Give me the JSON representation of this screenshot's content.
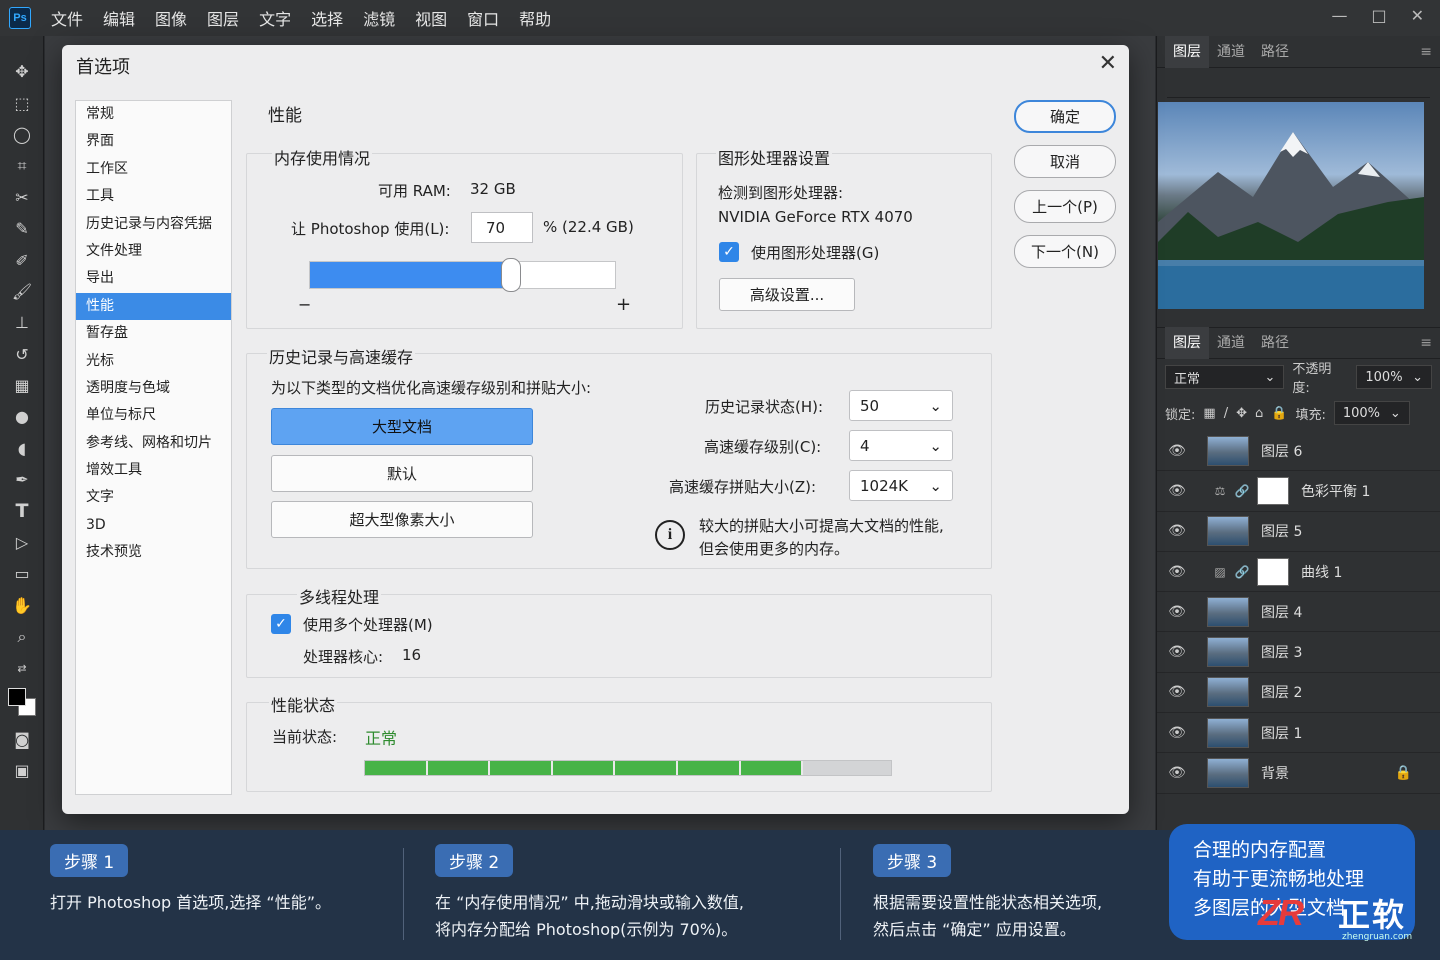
{
  "app": {
    "logo": "Ps",
    "menus": [
      "文件",
      "编辑",
      "图像",
      "图层",
      "文字",
      "选择",
      "滤镜",
      "视图",
      "窗口",
      "帮助"
    ]
  },
  "dialog": {
    "title": "首选项",
    "categories": [
      "常规",
      "界面",
      "工作区",
      "工具",
      "历史记录与内容凭据",
      "文件处理",
      "导出",
      "性能",
      "暂存盘",
      "光标",
      "透明度与色域",
      "单位与标尺",
      "参考线、网格和切片",
      "增效工具",
      "文字",
      "3D",
      "技术预览"
    ],
    "selected_category": "性能",
    "section_title": "性能",
    "memory": {
      "group_title": "内存使用情况",
      "available_label": "可用 RAM:",
      "available_value": "32 GB",
      "let_use_label": "让 Photoshop 使用(L):",
      "let_use_value": "70",
      "percent_text": "%  (22.4 GB)",
      "slider_percent": 0.66,
      "minus": "−",
      "plus": "+"
    },
    "gpu": {
      "group_title": "图形处理器设置",
      "detected_label": "检测到图形处理器:",
      "gpu_name": "NVIDIA GeForce RTX 4070",
      "use_gpu_label": "使用图形处理器(G)",
      "use_gpu_checked": true,
      "advanced_button": "高级设置..."
    },
    "history_cache": {
      "group_title": "历史记录与高速缓存",
      "description": "为以下类型的文档优化高速缓存级别和拼贴大小:",
      "buttons": [
        "大型文档",
        "默认",
        "超大型像素大小"
      ],
      "selected_button": "大型文档",
      "history_states_label": "历史记录状态(H):",
      "history_states_value": "50",
      "cache_levels_label": "高速缓存级别(C):",
      "cache_levels_value": "4",
      "cache_tile_label": "高速缓存拼贴大小(Z):",
      "cache_tile_value": "1024K",
      "info_line1": "较大的拼贴大小可提高大文档的性能,",
      "info_line2": "但会使用更多的内存。"
    },
    "multithread": {
      "group_title": "多线程处理",
      "use_multi_label": "使用多个处理器(M)",
      "use_multi_checked": true,
      "cores_label": "处理器核心:",
      "cores_value": "16"
    },
    "perf_status": {
      "group_title": "性能状态",
      "current_label": "当前状态:",
      "current_value": "正常",
      "filled_segments": 7,
      "status_color": "#47b347"
    },
    "side_buttons": {
      "ok": "确定",
      "cancel": "取消",
      "prev": "上一个(P)",
      "next": "下一个(N)"
    }
  },
  "right_panel": {
    "top_tabs": [
      "图层",
      "通道",
      "路径"
    ],
    "layers_tabs": [
      "图层",
      "通道",
      "路径"
    ],
    "blend_mode": "正常",
    "opacity_label": "不透明度:",
    "opacity_value": "100%",
    "lock_label": "锁定:",
    "fill_label": "填充:",
    "fill_value": "100%",
    "layers": [
      {
        "name": "图层 6",
        "type": "image"
      },
      {
        "name": "色彩平衡 1",
        "type": "adjustment",
        "icon": "scale-icon"
      },
      {
        "name": "图层 5",
        "type": "image"
      },
      {
        "name": "曲线 1",
        "type": "adjustment",
        "icon": "curves-icon"
      },
      {
        "name": "图层 4",
        "type": "image"
      },
      {
        "name": "图层 3",
        "type": "image"
      },
      {
        "name": "图层 2",
        "type": "image"
      },
      {
        "name": "图层 1",
        "type": "image"
      },
      {
        "name": "背景",
        "type": "background",
        "locked": true
      }
    ]
  },
  "steps": [
    {
      "badge": "步骤 1",
      "lines": [
        "打开 Photoshop 首选项,选择 “性能”。"
      ]
    },
    {
      "badge": "步骤 2",
      "lines": [
        "在 “内存使用情况” 中,拖动滑块或输入数值,",
        "将内存分配给 Photoshop(示例为 70%)。"
      ]
    },
    {
      "badge": "步骤 3",
      "lines": [
        "根据需要设置性能状态相关选项,",
        "然后点击 “确定” 应用设置。"
      ]
    }
  ],
  "callout": {
    "lines": [
      "合理的内存配置",
      "有助于更流畅地处理",
      "多图层的大型文档"
    ]
  },
  "watermark": {
    "logo": "ZR",
    "text": "正软",
    "url": "zhengruan.com"
  }
}
